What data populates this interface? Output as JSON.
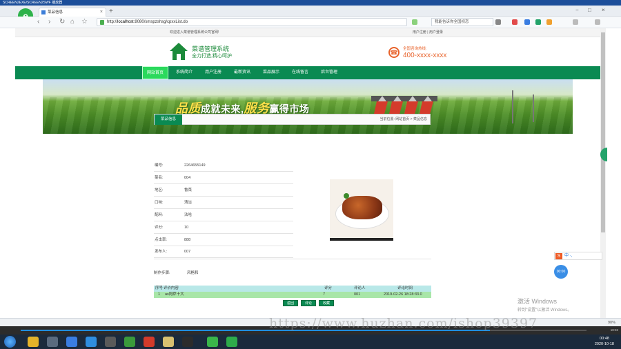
{
  "player": {
    "title": "SCREEN2EXE/SCREEN2SWF 播放器"
  },
  "browser": {
    "tab_title": "菜品信息",
    "url_host": "localhost",
    "url_path": ":8080/smspzshsg/cpxxList.do",
    "url_scheme": "http://",
    "search_placeholder": "我能告诉你全国初恋",
    "zoom": "90%"
  },
  "site": {
    "welcome": "欢迎进入菜谱管理系统公司官网!",
    "top_links": [
      "用户注册",
      "|",
      "用户登录"
    ],
    "title": "菜谱管理系统",
    "slogan": "全力打造,精心呵护",
    "hotline_label": "全国咨询热线:",
    "hotline_number": "400-xxxx-xxxx"
  },
  "menu": [
    {
      "label": "网站首页",
      "active": true
    },
    {
      "label": "系统简介",
      "active": false
    },
    {
      "label": "用户注册",
      "active": false
    },
    {
      "label": "最新资讯",
      "active": false
    },
    {
      "label": "菜品展示",
      "active": false
    },
    {
      "label": "在线留言",
      "active": false
    },
    {
      "label": "后台管理",
      "active": false
    }
  ],
  "banner": {
    "text_part1": "品质",
    "text_part2": "成就未来,",
    "text_part3": "服务",
    "text_part4": "赢得市场"
  },
  "content": {
    "tab": "菜品信息",
    "breadcrumb": "当前位置: 网站首页 > 菜品信息",
    "fields": [
      {
        "key": "编号:",
        "value": "2264655149"
      },
      {
        "key": "菜名:",
        "value": "004"
      },
      {
        "key": "地区:",
        "value": "鲁菜"
      },
      {
        "key": "口味:",
        "value": "清淡"
      },
      {
        "key": "配料:",
        "value": "法哈"
      },
      {
        "key": "评分:",
        "value": "10"
      },
      {
        "key": "点击率:",
        "value": "888"
      },
      {
        "key": "发布人:",
        "value": "007"
      }
    ],
    "steps_label": "制作步骤:",
    "steps_value": "风格和"
  },
  "comments": {
    "headers": [
      "序号",
      "评价内容",
      "评分",
      "评论人",
      "评论时间"
    ],
    "rows": [
      {
        "index": "1",
        "content": "as阿萨十大",
        "score": "7",
        "user": "001",
        "time": "2019-02-26 18:28:33.0"
      }
    ],
    "buttons": [
      "返回",
      "评论",
      "收藏"
    ]
  },
  "system": {
    "activate_title": "激活 Windows",
    "activate_sub": "转到\"设置\"以激活 Windows。",
    "watermark": "https://www.huzhan.com/ishop39397",
    "float_ball": "00:00",
    "ime_label": "中 ·,",
    "clock_time": "00:48",
    "clock_date": "2020-10-18",
    "player_time": "18:32"
  },
  "colors": {
    "primary_green": "#0a8a52",
    "active_menu": "#2bd95d",
    "hotline_orange": "#e8632b"
  }
}
